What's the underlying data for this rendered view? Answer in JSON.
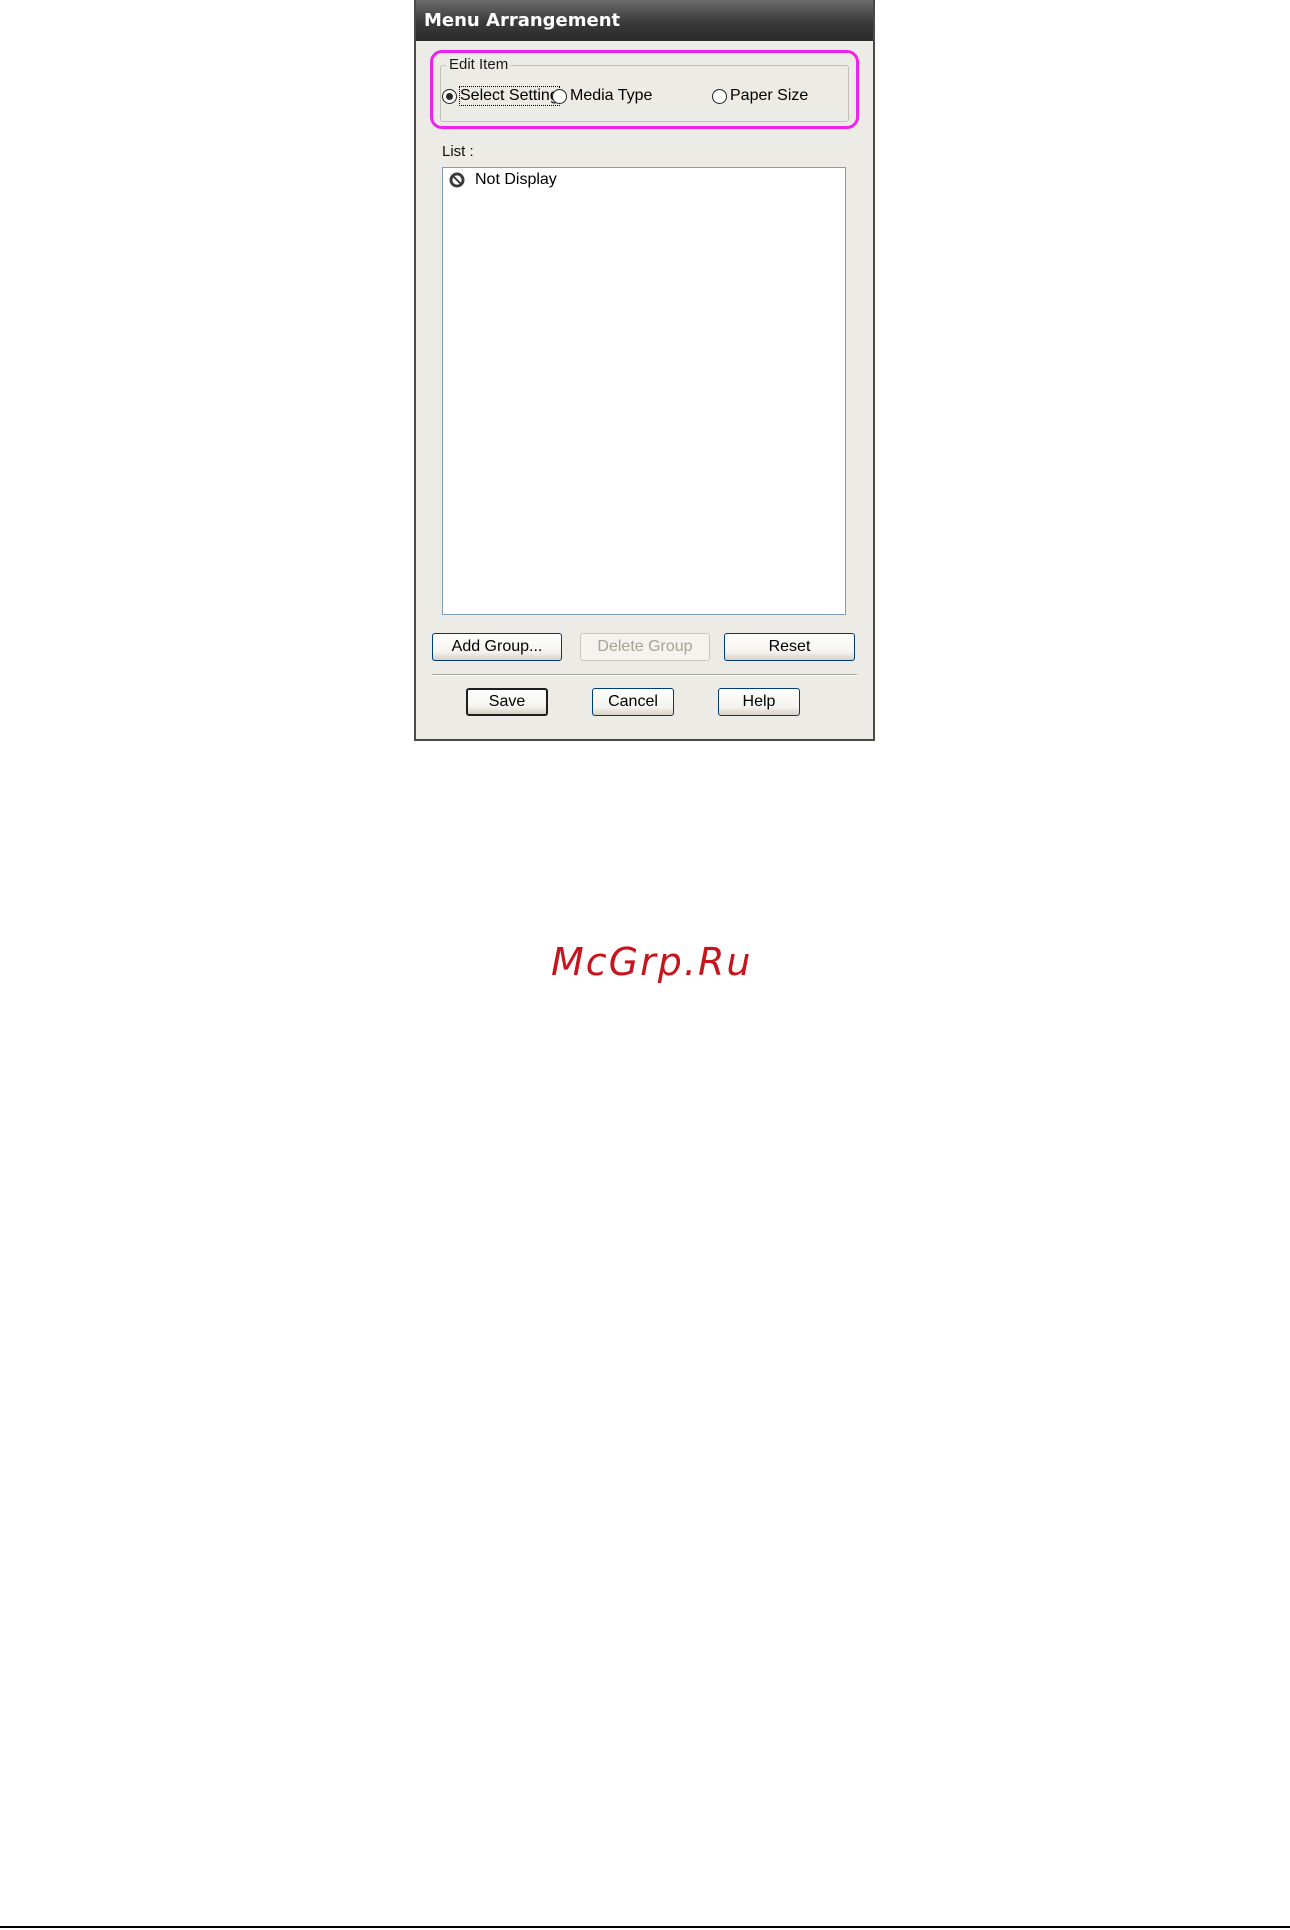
{
  "window": {
    "title": "Menu Arrangement"
  },
  "edit_item": {
    "legend": "Edit Item",
    "options": [
      {
        "label": "Select Setting",
        "selected": true
      },
      {
        "label": "Media Type",
        "selected": false
      },
      {
        "label": "Paper Size",
        "selected": false
      }
    ]
  },
  "list": {
    "label": "List :",
    "items": [
      {
        "label": "Not Display",
        "icon": "not-display-icon"
      }
    ]
  },
  "buttons": {
    "add_group": "Add Group...",
    "delete_group": "Delete Group",
    "reset": "Reset",
    "save": "Save",
    "cancel": "Cancel",
    "help": "Help"
  },
  "watermark": "McGrp.Ru",
  "colors": {
    "highlight": "#ee22ee",
    "watermark": "#c8151d",
    "titlebar": "#3a3a3a"
  }
}
